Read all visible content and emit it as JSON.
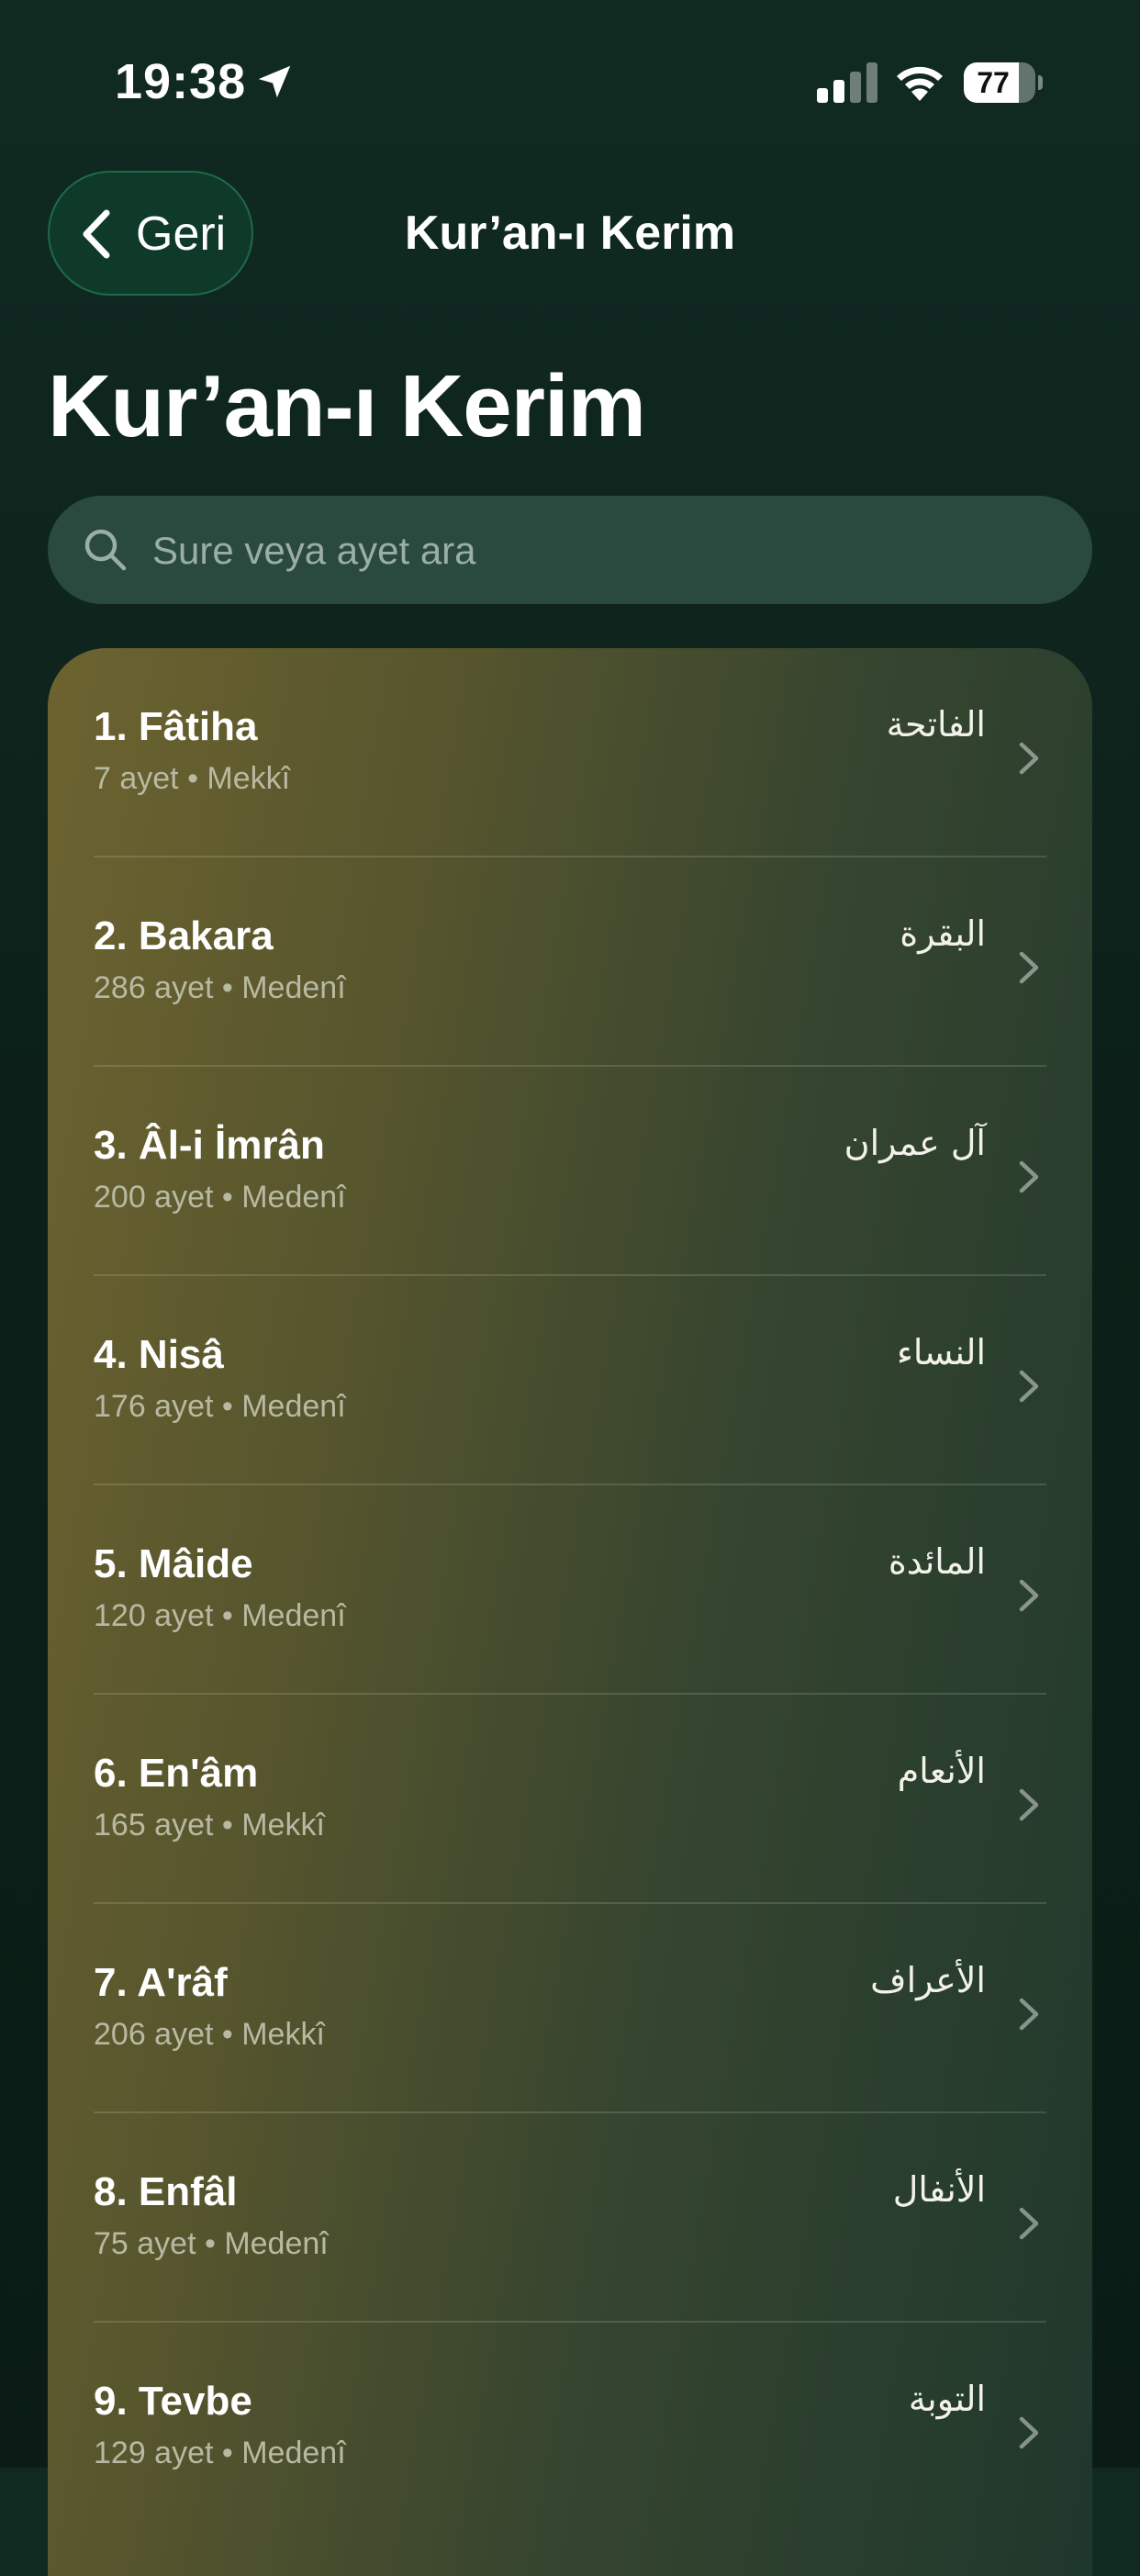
{
  "status_bar": {
    "time": "19:38",
    "battery": "77",
    "battery_level": 0.77
  },
  "nav": {
    "back_label": "Geri",
    "title": "Kur’an-ı Kerim"
  },
  "page": {
    "large_title": "Kur’an-ı Kerim"
  },
  "search": {
    "placeholder": "Sure veya ayet ara"
  },
  "surahs": [
    {
      "name": "1. Fâtiha",
      "meta": "7 ayet • Mekkî",
      "arabic": "الفاتحة"
    },
    {
      "name": "2. Bakara",
      "meta": "286 ayet • Medenî",
      "arabic": "البقرة"
    },
    {
      "name": "3. Âl-i İmrân",
      "meta": "200 ayet • Medenî",
      "arabic": "آل عمران"
    },
    {
      "name": "4. Nisâ",
      "meta": "176 ayet • Medenî",
      "arabic": "النساء"
    },
    {
      "name": "5. Mâide",
      "meta": "120 ayet • Medenî",
      "arabic": "المائدة"
    },
    {
      "name": "6. En'âm",
      "meta": "165 ayet • Mekkî",
      "arabic": "الأنعام"
    },
    {
      "name": "7. A'râf",
      "meta": "206 ayet • Mekkî",
      "arabic": "الأعراف"
    },
    {
      "name": "8. Enfâl",
      "meta": "75 ayet • Medenî",
      "arabic": "الأنفال"
    },
    {
      "name": "9. Tevbe",
      "meta": "129 ayet • Medenî",
      "arabic": "التوبة"
    }
  ]
}
